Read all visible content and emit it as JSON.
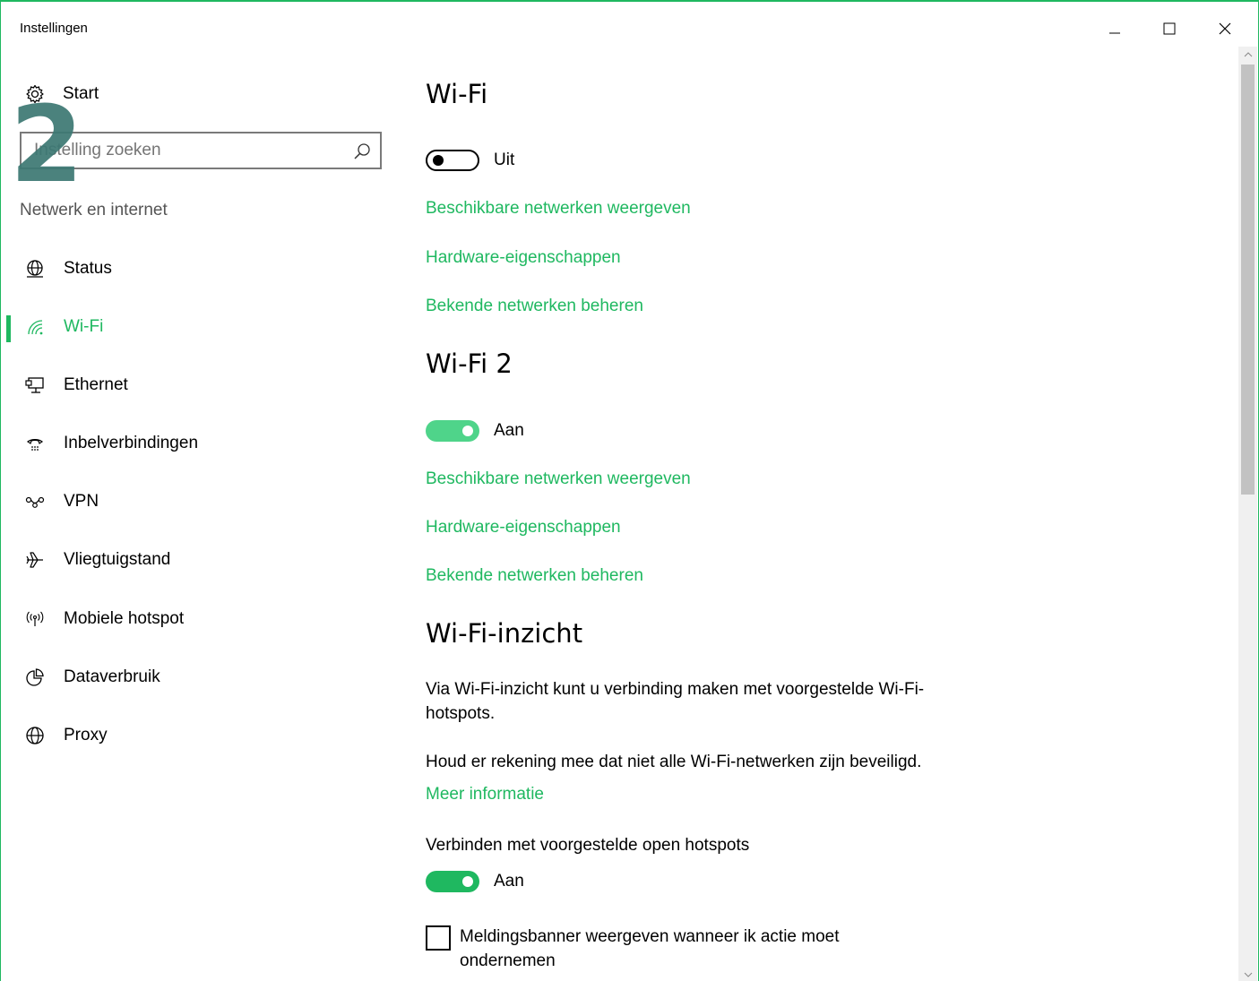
{
  "window": {
    "title": "Instellingen"
  },
  "sidebar": {
    "home_label": "Start",
    "search": {
      "value": "",
      "placeholder": "Instelling zoeken"
    },
    "overlay_number": "2",
    "section_label": "Netwerk en internet",
    "items": [
      {
        "label": "Status",
        "icon": "globe-status-icon"
      },
      {
        "label": "Wi-Fi",
        "icon": "wifi-icon",
        "active": true
      },
      {
        "label": "Ethernet",
        "icon": "ethernet-icon"
      },
      {
        "label": "Inbelverbindingen",
        "icon": "dialup-icon"
      },
      {
        "label": "VPN",
        "icon": "vpn-icon"
      },
      {
        "label": "Vliegtuigstand",
        "icon": "airplane-icon"
      },
      {
        "label": "Mobiele hotspot",
        "icon": "hotspot-icon"
      },
      {
        "label": "Dataverbruik",
        "icon": "data-usage-icon"
      },
      {
        "label": "Proxy",
        "icon": "globe-icon"
      }
    ]
  },
  "main": {
    "wifi1": {
      "title": "Wi-Fi",
      "toggle_state": "Uit",
      "toggle_on": false,
      "links": [
        "Beschikbare netwerken weergeven",
        "Hardware-eigenschappen",
        "Bekende netwerken beheren"
      ]
    },
    "wifi2": {
      "title": "Wi-Fi 2",
      "toggle_state": "Aan",
      "toggle_on": true,
      "links": [
        "Beschikbare netwerken weergeven",
        "Hardware-eigenschappen",
        "Bekende netwerken beheren"
      ]
    },
    "sense": {
      "title": "Wi-Fi-inzicht",
      "description": "Via Wi-Fi-inzicht kunt u verbinding maken met voorgestelde Wi-Fi-hotspots.",
      "warning": "Houd er rekening mee dat niet alle Wi-Fi-netwerken zijn beveiligd.",
      "more_info": "Meer informatie",
      "open_hotspots_label": "Verbinden met voorgestelde open hotspots",
      "open_hotspots_state": "Aan",
      "open_hotspots_on": true,
      "banner_checkbox_label": "Meldingsbanner weergeven wanneer ik actie moet ondernemen",
      "banner_checkbox_checked": false
    }
  },
  "colors": {
    "accent": "#1fb860",
    "accent_light": "#4fd48a",
    "overlay": "#3c7873"
  }
}
